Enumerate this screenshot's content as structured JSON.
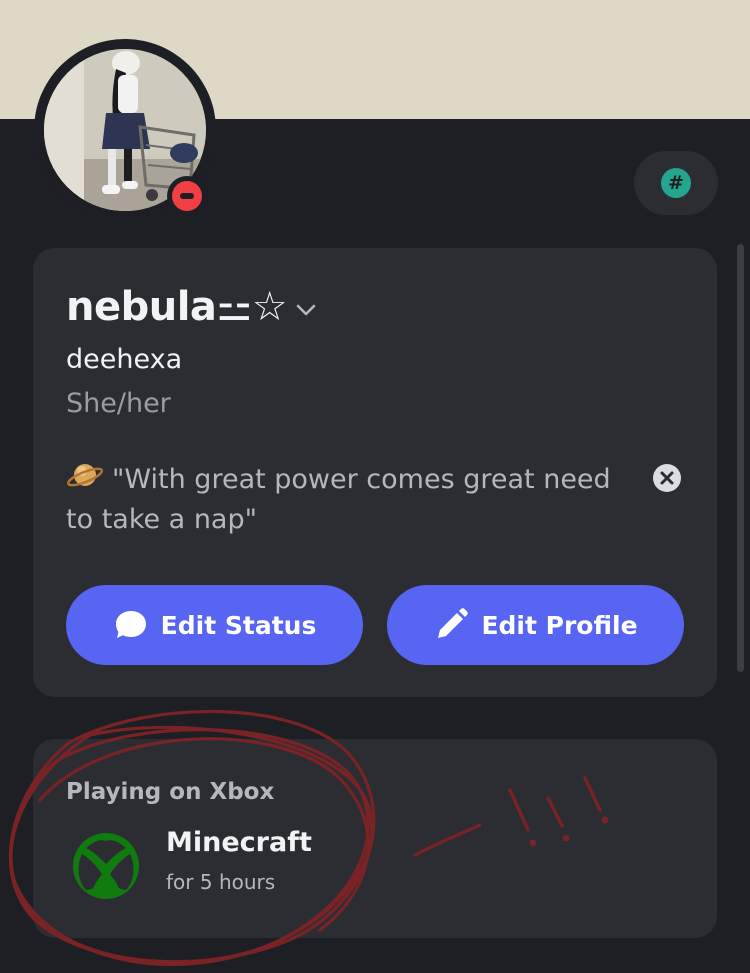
{
  "theme": {
    "banner_color": "#ddd9c6",
    "background": "#1e1f24",
    "card_background": "#2b2d33",
    "accent": "#5865f2",
    "dnd_red": "#f23f43",
    "badge_green": "#23a58e",
    "xbox_green": "#107c10",
    "annotation_color": "#7a2326"
  },
  "profile": {
    "avatar_icon": "avatar-photo",
    "presence_icon": "do-not-disturb-icon",
    "badge_icon": "hashtag-badge-icon",
    "badge_symbol": "#",
    "display_name": "nebula⚍☆",
    "username": "deehexa",
    "pronouns": "She/her"
  },
  "status": {
    "emoji_icon": "ringed-planet-icon",
    "text": "\"With great power comes great need to take a nap\"",
    "clear_icon": "clear-status-icon"
  },
  "buttons": {
    "edit_status": {
      "label": "Edit Status",
      "icon": "speech-bubble-icon"
    },
    "edit_profile": {
      "label": "Edit Profile",
      "icon": "pencil-icon"
    }
  },
  "activity": {
    "heading": "Playing on Xbox",
    "platform_icon": "xbox-logo-icon",
    "game": "Minecraft",
    "duration": "for 5 hours"
  },
  "annotation": {
    "mark": "!!!"
  }
}
